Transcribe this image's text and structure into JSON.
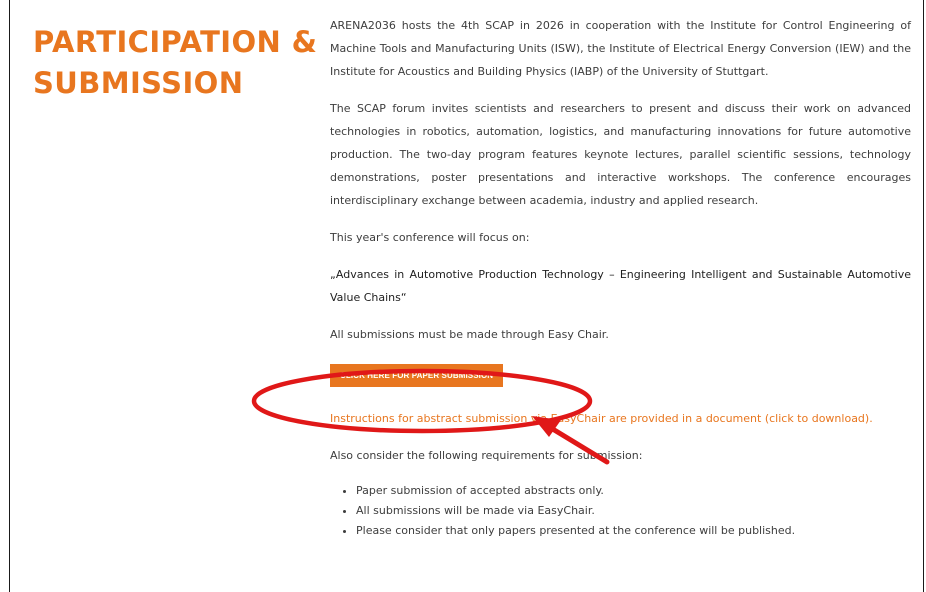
{
  "section": {
    "heading_line1": "PARTICIPATION &",
    "heading_line2": "SUBMISSION"
  },
  "content": {
    "intro": "ARENA2036 hosts the 4th SCAP in 2026 in cooperation with the Institute for Control Engineering of Machine Tools and Manufacturing Units (ISW), the Institute of Electrical Energy Conversion (IEW) and the Institute for Acoustics and Building Physics (IABP) of the University of Stuttgart.",
    "forum": "The SCAP forum invites scientists and researchers to present and discuss their work on advanced technologies in robotics, automation, logistics, and manufacturing innovations for future automotive production. The two-day program features keynote lectures, parallel scientific sessions, technology demonstrations, poster presentations and interactive workshops. The conference encourages interdisciplinary exchange between academia, industry and applied research.",
    "focus_intro": "This year's conference will focus on:",
    "focus_title": "„Advances in Automotive Production Technology – Engineering Intelligent and Sustainable Automotive Value Chains“",
    "easychair_note": "All submissions must be made through Easy Chair.",
    "submit_button": "CLICK HERE FOR PAPER SUBMISSION",
    "instructions_link": "Instructions for abstract submission via EasyChair are provided in a document (click to download).",
    "requirements_intro": "Also consider the following requirements for submission:",
    "requirements": [
      "Paper submission of accepted abstracts only.",
      "All submissions will be made via EasyChair.",
      "Please consider that only papers presented at the conference will be published."
    ]
  },
  "colors": {
    "accent": "#e8761f",
    "annotation": "#e01818"
  }
}
